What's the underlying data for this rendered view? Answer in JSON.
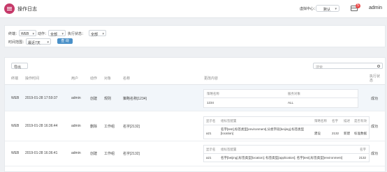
{
  "header": {
    "title": "操作日志",
    "env_label": "虚拟中心：",
    "env_value": "默认",
    "badge_count": "5",
    "user": "admin"
  },
  "filters": {
    "terminal_label": "终端：",
    "terminal_value": "WEB",
    "action_label": "动作：",
    "action_value": "全部",
    "status_label": "执行状态：",
    "status_value": "全部",
    "time_label": "时间范围：",
    "time_value": "最近7天",
    "query_label": "查 询"
  },
  "toolbar": {
    "export_label": "导出",
    "search_placeholder": "搜索"
  },
  "columns": [
    "终端",
    "操作时间",
    "用户",
    "动作",
    "对象",
    "名称",
    "更改内容",
    "执行状态"
  ],
  "rows": [
    {
      "terminal": "WEB",
      "time": "2019-01-28 17:59:37",
      "user": "admin",
      "action": "创建",
      "object": "规则",
      "name": "策略名称[1234]",
      "status": "成功",
      "detail": {
        "headers": [
          "策略名称",
          "服务对象"
        ],
        "values": [
          "1234",
          "ALL"
        ]
      }
    },
    {
      "terminal": "WEB",
      "time": "2019-01-28 16:36:44",
      "user": "admin",
      "action": "删除",
      "object": "工作组",
      "name": "名字[2132]",
      "status": "成功",
      "detail": {
        "headers": [
          "显示名",
          "组标签配置",
          "策略名称",
          "名字",
          "描述",
          "是否有效"
        ],
        "values": [
          "a21",
          "名字[test],标签类型[environment],分类字段[beijing],标签类型[location]",
          "建设",
          "2132",
          "新建",
          "标准数据"
        ]
      }
    },
    {
      "terminal": "WEB",
      "time": "2019-01-28 16:36:41",
      "user": "admin",
      "action": "创建",
      "object": "工作组",
      "name": "名字[2132]",
      "status": "成功",
      "detail": {
        "headers": [
          "显示名",
          "组标签配置",
          "名字"
        ],
        "values": [
          "a21",
          "名字[beijing],标签类型[location]; 标签类型[application]; 名字[test],标签类型[environment]",
          "2132"
        ]
      }
    }
  ]
}
